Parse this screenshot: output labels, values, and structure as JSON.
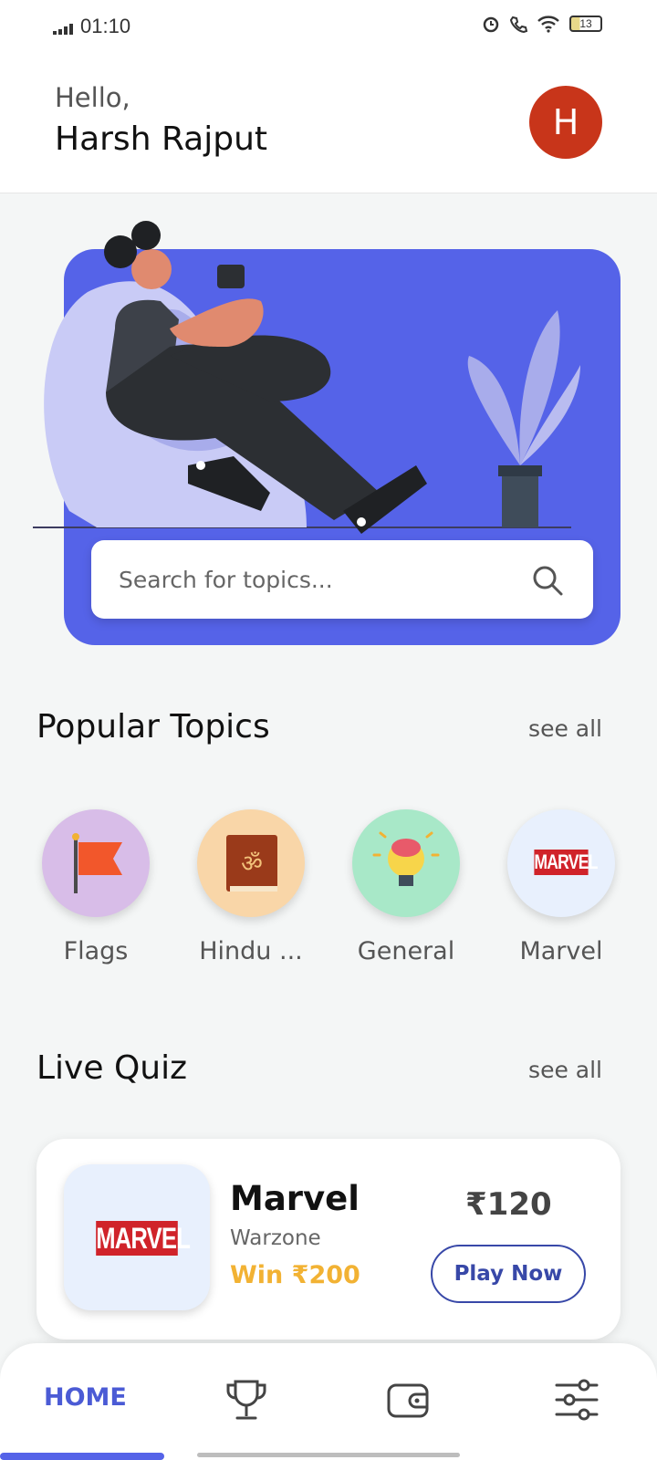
{
  "status_bar": {
    "time": "01:10",
    "battery": "13"
  },
  "header": {
    "greeting": "Hello,",
    "username": "Harsh Rajput",
    "avatar_initial": "H"
  },
  "search": {
    "placeholder": "Search for topics..."
  },
  "popular_topics": {
    "title": "Popular Topics",
    "see_all": "see all",
    "items": [
      {
        "label": "Flags",
        "icon": "flag-icon",
        "bg": "#d8bde8"
      },
      {
        "label": "Hindu ...",
        "icon": "om-book-icon",
        "bg": "#f9d6a8"
      },
      {
        "label": "General",
        "icon": "lightbulb-brain-icon",
        "bg": "#a8e8c8"
      },
      {
        "label": "Marvel",
        "icon": "marvel-logo-icon",
        "bg": "#e8f0fd"
      }
    ]
  },
  "live_quiz": {
    "title": "Live Quiz",
    "see_all": "see all",
    "card": {
      "thumb_logo": "MARVEL",
      "name": "Marvel",
      "subtitle": "Warzone",
      "win": "Win ₹200",
      "price": "₹120",
      "button": "Play Now"
    }
  },
  "nav": {
    "home_label": "HOME",
    "icons": [
      "trophy-icon",
      "wallet-icon",
      "settings-sliders-icon"
    ]
  },
  "colors": {
    "accent": "#5563e8",
    "avatar": "#c8351a",
    "win": "#f2b233",
    "button": "#3848a8"
  }
}
